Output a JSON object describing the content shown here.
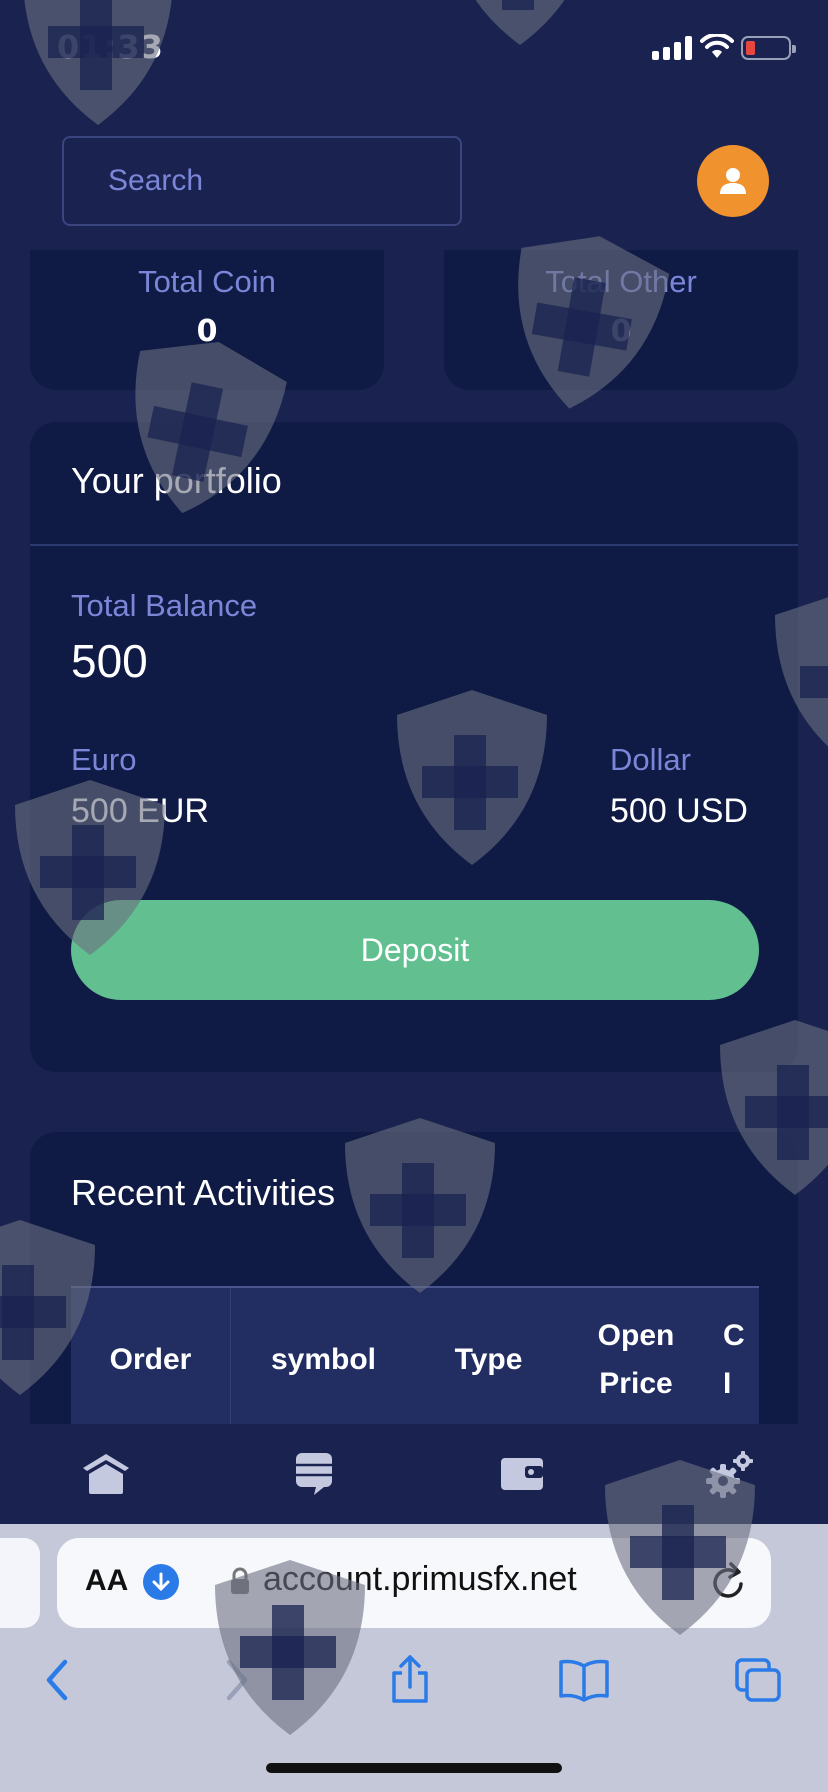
{
  "status_bar": {
    "time": "01:33"
  },
  "search": {
    "placeholder": "Search"
  },
  "stats": {
    "total_coin_label": "Total Coin",
    "total_coin_value": "0",
    "total_other_label": "Total Other",
    "total_other_value": "0"
  },
  "portfolio": {
    "title": "Your portfolio",
    "total_balance_label": "Total Balance",
    "total_balance_value": "500",
    "euro_label": "Euro",
    "euro_value": "500 EUR",
    "dollar_label": "Dollar",
    "dollar_value": "500 USD",
    "deposit_label": "Deposit"
  },
  "activities": {
    "title": "Recent Activities",
    "columns": [
      "Order",
      "symbol",
      "Type",
      "Open\nPrice",
      "C\nI"
    ]
  },
  "bottom_nav": {
    "icons": [
      "home-icon",
      "messages-icon",
      "wallet-icon",
      "settings-icon"
    ]
  },
  "browser": {
    "aa_label": "AA",
    "url": "account.primusfx.net"
  },
  "colors": {
    "background": "#1a2350",
    "card": "#0f1a45",
    "accent_text": "#7b86d8",
    "deposit": "#61bf90",
    "avatar": "#f0922e"
  }
}
